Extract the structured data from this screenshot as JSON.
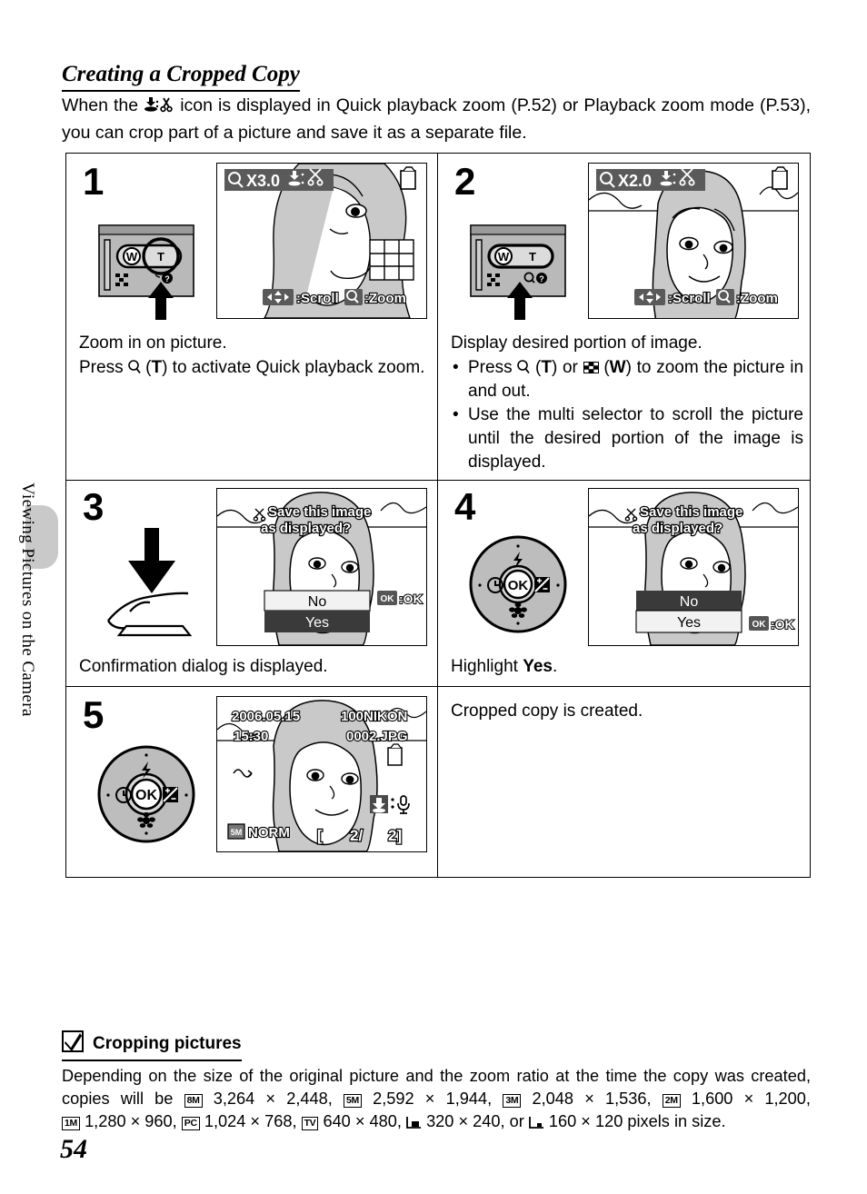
{
  "sidebar": {
    "chapter_label": "Viewing Pictures on the Camera"
  },
  "header": {
    "title": "Creating a Cropped Copy",
    "intro_part1": "When the",
    "intro_icon": "crop-save-scissors-icon",
    "intro_part2": "icon is displayed in Quick playback zoom (P.52) or Playback zoom mode (P.53), you can crop part of a picture and save it as a separate file."
  },
  "steps": [
    {
      "number": "1",
      "caption_lead": "Zoom in on picture.",
      "caption_body_a": "Press",
      "caption_icon": "magnifier-icon",
      "caption_body_b": "(",
      "caption_key": "T",
      "caption_body_c": ") to activate Quick playback zoom.",
      "lcd": {
        "zoom_label": "X3.0",
        "scroll_label": ":Scroll",
        "zoom_hint_label": ":Zoom",
        "icons": [
          "magnifier-icon",
          "save-icon",
          "scissors-icon",
          "battery-icon",
          "grid-icon",
          "multi-selector-icon"
        ]
      },
      "control": "zoom-rocker-T-pressed"
    },
    {
      "number": "2",
      "caption_lead": "Display desired portion of image.",
      "bullets": [
        {
          "text_a": "Press",
          "icon_a": "magnifier-icon",
          "text_b": "(",
          "key_a": "T",
          "text_c": ") or",
          "icon_b": "thumbnail-icon",
          "text_d": "(",
          "key_b": "W",
          "text_e": ") to zoom the picture in and out."
        },
        {
          "text_a": "Use the multi selector to scroll the picture until the desired portion of the image is displayed."
        }
      ],
      "lcd": {
        "zoom_label": "X2.0",
        "scroll_label": ":Scroll",
        "zoom_hint_label": ":Zoom",
        "icons": [
          "magnifier-icon",
          "save-icon",
          "scissors-icon",
          "battery-icon",
          "multi-selector-icon"
        ]
      },
      "control": "zoom-rocker-W-pressed"
    },
    {
      "number": "3",
      "caption_lead": "Confirmation dialog is displayed.",
      "lcd": {
        "dialog_line1": "Save this image",
        "dialog_line2": "as displayed?",
        "option_no": "No",
        "option_yes": "Yes",
        "ok_badge": "OK",
        "ok_label": ":OK",
        "selected": "No",
        "icons": [
          "scissors-icon",
          "ok-button-icon"
        ]
      },
      "control": "press-down-finger-icon"
    },
    {
      "number": "4",
      "caption_lead_a": "Highlight",
      "caption_lead_bold": "Yes",
      "caption_lead_b": ".",
      "lcd": {
        "dialog_line1": "Save this image",
        "dialog_line2": "as displayed?",
        "option_no": "No",
        "option_yes": "Yes",
        "ok_badge": "OK",
        "ok_label": ":OK",
        "selected": "Yes",
        "icons": [
          "scissors-icon",
          "ok-button-icon"
        ]
      },
      "control": "multi-selector-dial"
    },
    {
      "number": "5",
      "caption_lead": "Cropped copy is created.",
      "lcd": {
        "date": "2006.05.15",
        "time": "15:30",
        "folder": "100NIKON",
        "filename": "0002.JPG",
        "quality": "NORM",
        "frame_counter_left": "[",
        "frame_current": "2/",
        "frame_total": "2]",
        "icons": [
          "battery-icon",
          "quality-icon",
          "save-icon",
          "microphone-icon",
          "crop-mark-icon"
        ]
      },
      "control": "multi-selector-dial"
    }
  ],
  "multi_selector": {
    "flash_icon": "flash-icon",
    "timer_icon": "self-timer-icon",
    "ok_label": "OK",
    "exposure_icon": "exposure-compensation-icon",
    "macro_icon": "macro-flower-icon"
  },
  "zoom_rocker": {
    "wide_label": "W",
    "tele_label": "T",
    "thumbnail_icon": "thumbnail-icon",
    "help_icon": "help-icon",
    "magnifier_icon": "magnifier-icon"
  },
  "footnote": {
    "check_icon": "checkmark-icon",
    "title": "Cropping pictures",
    "intro": "Depending on the size of the original picture and the zoom ratio at the time the copy was created, copies will be",
    "sizes": [
      {
        "badge": "8M",
        "value": "3,264 × 2,448"
      },
      {
        "badge": "5M",
        "value": "2,592 × 1,944"
      },
      {
        "badge": "3M",
        "value": "2,048 × 1,536"
      },
      {
        "badge": "2M",
        "value": "1,600 × 1,200"
      },
      {
        "badge": "1M",
        "value": "1,280 × 960"
      },
      {
        "badge": "PC",
        "value": "1,024 × 768"
      },
      {
        "badge": "TV",
        "value": "640 × 480"
      },
      {
        "badge": "◥",
        "value": "320 × 240"
      },
      {
        "badge": "▪",
        "value": "160 × 120"
      }
    ],
    "separator_or": "or",
    "tail": "pixels in size."
  },
  "page_number": "54"
}
